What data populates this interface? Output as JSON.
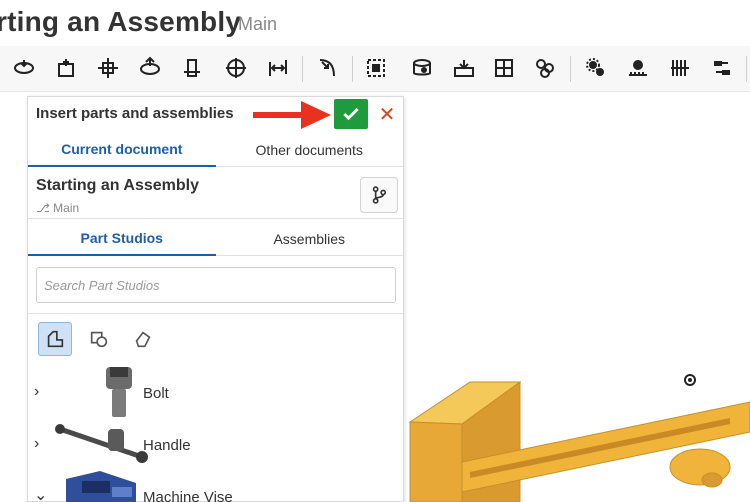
{
  "document": {
    "title": "rting an Assembly",
    "branch": "Main"
  },
  "toolbar": {
    "tools": [
      "insert-icon",
      "fasten-mate-icon",
      "revolute-mate-icon",
      "slider-mate-icon",
      "cylindrical-mate-icon",
      "pin-slot-mate-icon",
      "planar-mate-icon",
      "tangent-mate-icon",
      "group-icon",
      "mate-connector-icon",
      "replicate-icon",
      "pattern-icon",
      "linear-pattern-icon",
      "gear-relation-icon",
      "rack-pinion-relation-icon",
      "screw-relation-icon",
      "linear-relation-icon"
    ]
  },
  "panel": {
    "title": "Insert parts and assemblies",
    "accept_icon": "checkmark-icon",
    "cancel_symbol": "✕",
    "doc_tabs": [
      "Current document",
      "Other documents"
    ],
    "doc_name": "Starting an Assembly",
    "doc_branch": "Main",
    "type_tabs": [
      "Part Studios",
      "Assemblies"
    ],
    "search_placeholder": "Search Part Studios",
    "filters": [
      "parts-filter-icon",
      "surfaces-filter-icon",
      "sketches-filter-icon"
    ],
    "items": [
      {
        "label": "Bolt",
        "expanded": false
      },
      {
        "label": "Handle",
        "expanded": false
      },
      {
        "label": "Machine Vise",
        "expanded": true
      }
    ]
  },
  "colors": {
    "accept_green": "#1f9b3e",
    "cancel_red": "#d9441e",
    "active_tab_blue": "#1e5ea8",
    "arrow_red": "#e8321f",
    "model_yellow": "#f0b43a"
  }
}
